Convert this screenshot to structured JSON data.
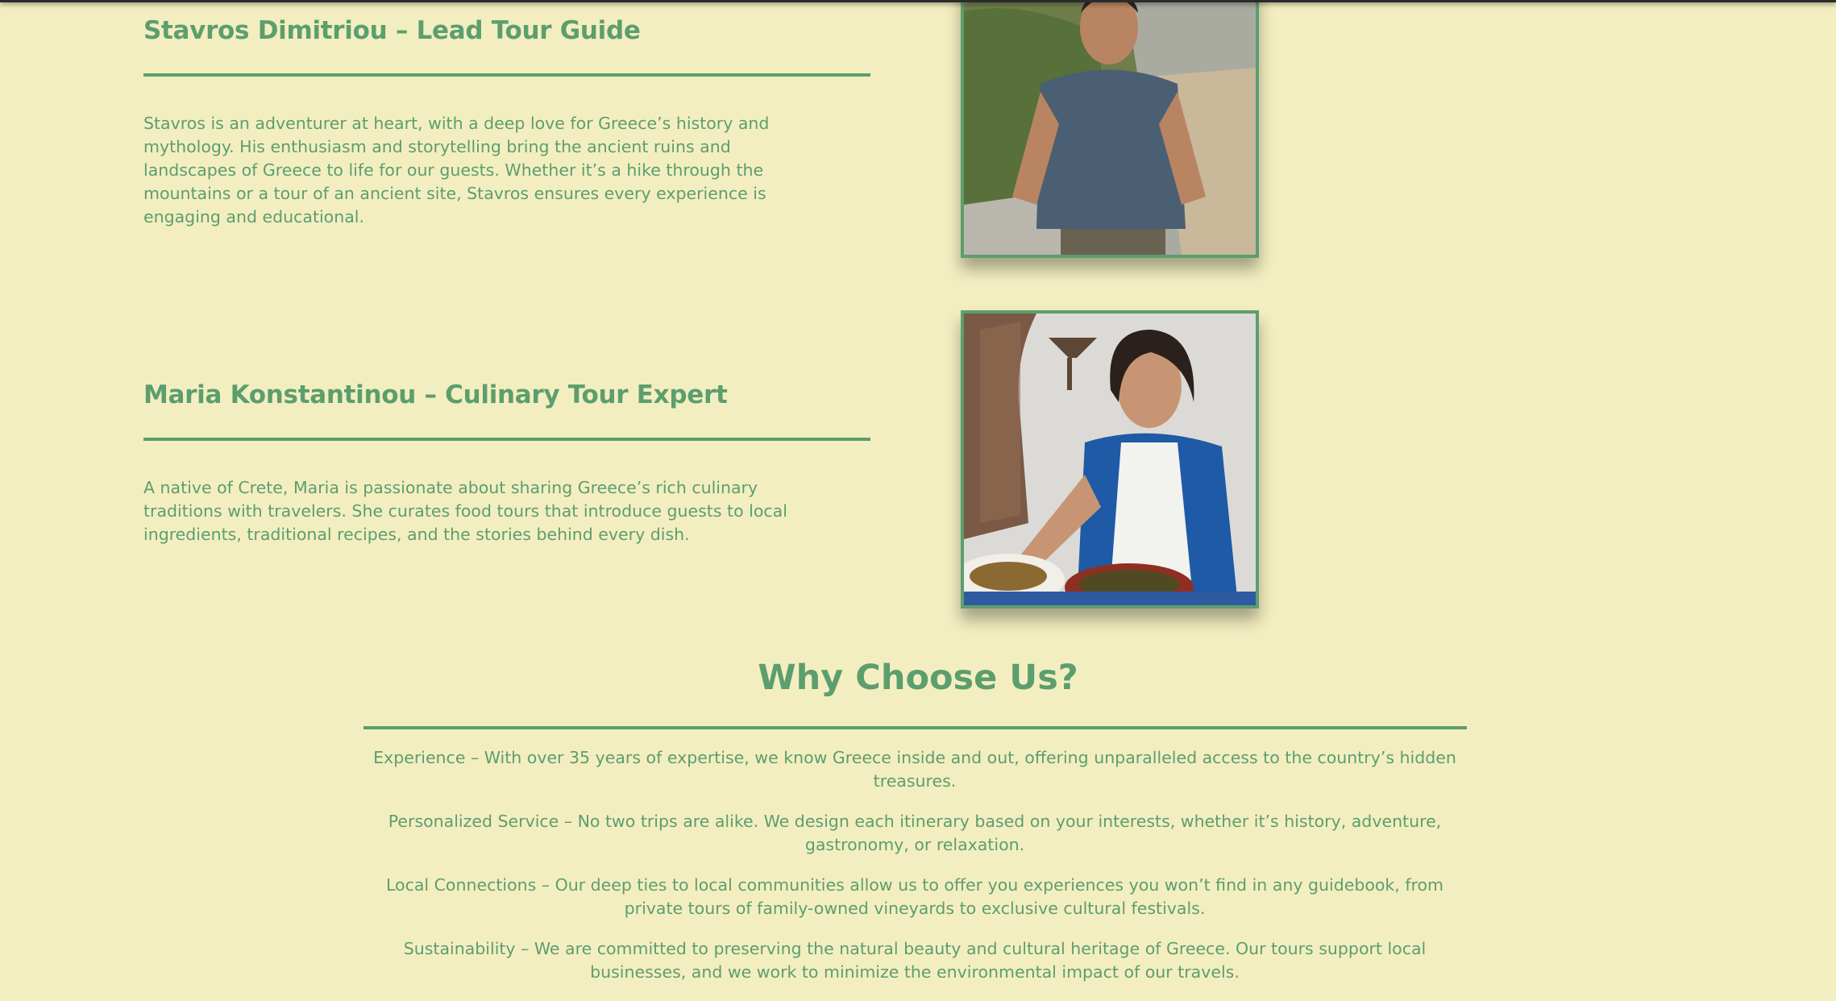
{
  "guides": [
    {
      "name": "Stavros Dimitriou – Lead Tour Guide",
      "bio": "Stavros is an adventurer at heart, with a deep love for Greece’s history and mythology. His enthusiasm and storytelling bring the ancient ruins and landscapes of Greece to life for our guests. Whether it’s a hike through the mountains or a tour of an ancient site, Stavros ensures every experience is engaging and educational."
    },
    {
      "name": "Maria Konstantinou – Culinary Tour Expert",
      "bio": "A native of Crete, Maria is passionate about sharing Greece’s rich culinary traditions with travelers. She curates food tours that introduce guests to local ingredients, traditional recipes, and the stories behind every dish."
    }
  ],
  "why": {
    "title": "Why Choose Us?",
    "items": [
      "Experience – With over 35 years of expertise, we know Greece inside and out, offering unparalleled access to the country’s hidden treasures.",
      "Personalized Service – No two trips are alike. We design each itinerary based on your interests, whether it’s history, adventure, gastronomy, or relaxation.",
      "Local Connections – Our deep ties to local communities allow us to offer you experiences you won’t find in any guidebook, from private tours of family-owned vineyards to exclusive cultural festivals.",
      "Sustainability – We are committed to preserving the natural beauty and cultural heritage of Greece. Our tours support local businesses, and we work to minimize the environmental impact of our travels."
    ]
  },
  "colors": {
    "background": "#f3eec0",
    "accent": "#5c9e6e"
  }
}
